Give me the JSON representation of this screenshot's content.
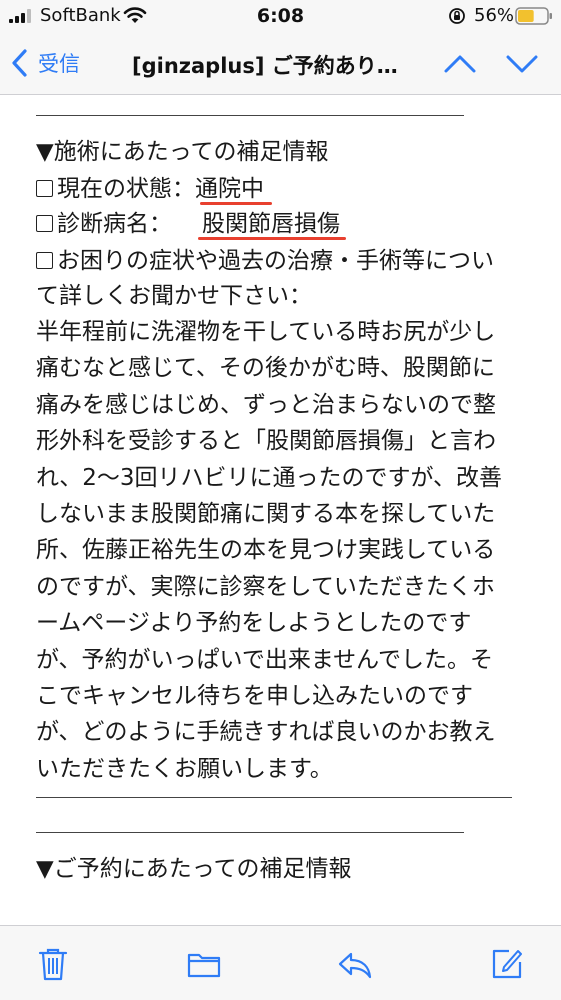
{
  "status_bar": {
    "carrier": "SoftBank",
    "time": "6:08",
    "battery_percent": "56%",
    "battery_level": 0.56,
    "signal_bars": 3
  },
  "nav": {
    "back_label": "受信",
    "title": "[ginzaplus] ご予約あり…"
  },
  "email": {
    "section1_heading": "▼施術にあたっての補足情報",
    "field_status_label": "現在の状態：",
    "field_status_value": "通院中",
    "field_diagnosis_label": "診断病名：",
    "field_diagnosis_value": "股関節唇損傷",
    "field_question_line1": "お困りの症状や過去の治療・手術等につい",
    "field_question_line2": "て詳しくお聞かせ下さい：",
    "body_lines": [
      "半年程前に洗濯物を干している時お尻が少し",
      "痛むなと感じて、その後かがむ時、股関節に",
      "痛みを感じはじめ、ずっと治まらないので整",
      "形外科を受診すると「股関節唇損傷」と言わ",
      "れ、2〜3回リハビリに通ったのですが、改善",
      "しないまま股関節痛に関する本を探していた",
      "所、佐藤正裕先生の本を見つけ実践している",
      "のですが、実際に診察をしていただきたくホ",
      "ームページより予約をしようとしたのです",
      "が、予約がいっぱいで出来ませんでした。そ",
      "こでキャンセル待ちを申し込みたいのです",
      "が、どのように手続きすれば良いのかお教え",
      "いただきたくお願いします。"
    ],
    "section2_heading": "▼ご予約にあたっての補足情報"
  },
  "toolbar": {
    "items": [
      "trash-icon",
      "folder-icon",
      "reply-icon",
      "compose-icon"
    ]
  },
  "colors": {
    "accent": "#2f7cf6",
    "underline": "#e8402f",
    "bar_bg": "#f7f7f7",
    "battery_fill": "#f2c12e"
  }
}
